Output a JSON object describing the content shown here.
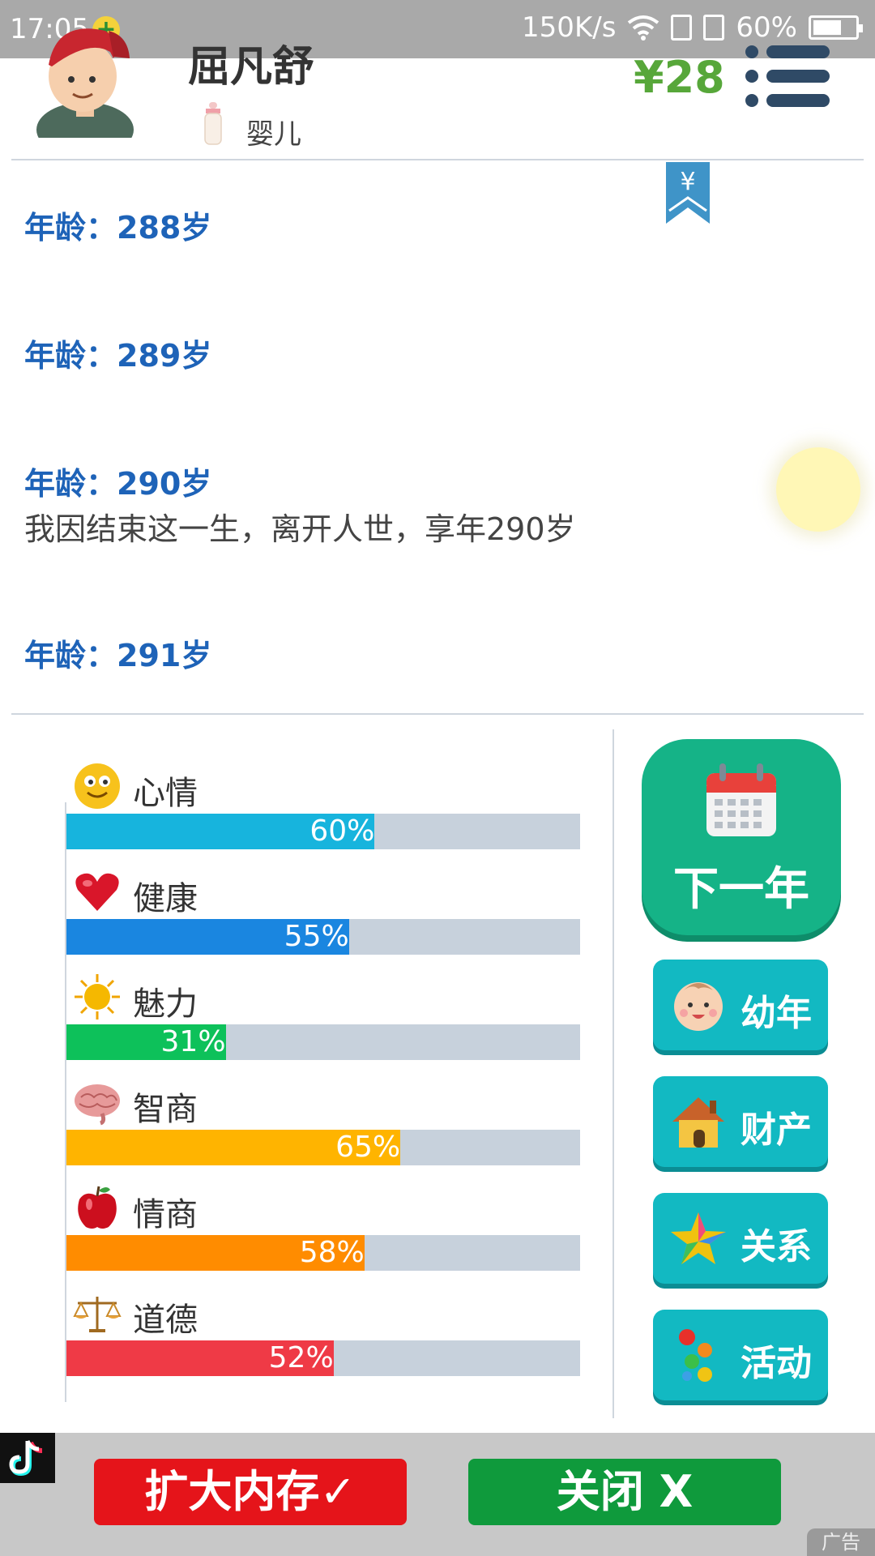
{
  "status_bar": {
    "time": "17:05",
    "plus": "+",
    "network_speed": "150K/s",
    "battery": "60%"
  },
  "header": {
    "name": "屈凡舒",
    "stage": "婴儿",
    "money": "¥28",
    "ribbon_symbol": "¥"
  },
  "log": [
    {
      "age": "年龄：288岁",
      "event": ""
    },
    {
      "age": "年龄：289岁",
      "event": ""
    },
    {
      "age": "年龄：290岁",
      "event": "我因结束这一生，离开人世，享年290岁"
    },
    {
      "age": "年龄：291岁",
      "event": ""
    }
  ],
  "stats": [
    {
      "label": "心情",
      "value": 60,
      "text": "60%",
      "color": "#17b4dd",
      "icon": "smiley-icon"
    },
    {
      "label": "健康",
      "value": 55,
      "text": "55%",
      "color": "#1a86e0",
      "icon": "heart-icon"
    },
    {
      "label": "魅力",
      "value": 31,
      "text": "31%",
      "color": "#0dc15a",
      "icon": "sun-icon"
    },
    {
      "label": "智商",
      "value": 65,
      "text": "65%",
      "color": "#ffb400",
      "icon": "brain-icon"
    },
    {
      "label": "情商",
      "value": 58,
      "text": "58%",
      "color": "#ff8c00",
      "icon": "apple-icon"
    },
    {
      "label": "道德",
      "value": 52,
      "text": "52%",
      "color": "#ef3a46",
      "icon": "scales-icon"
    }
  ],
  "buttons": {
    "next_year": "下一年",
    "childhood": "幼年",
    "property": "财产",
    "relations": "关系",
    "activities": "活动"
  },
  "ad": {
    "expand": "扩大内存✓",
    "close": "关闭  X",
    "tag": "广告"
  }
}
